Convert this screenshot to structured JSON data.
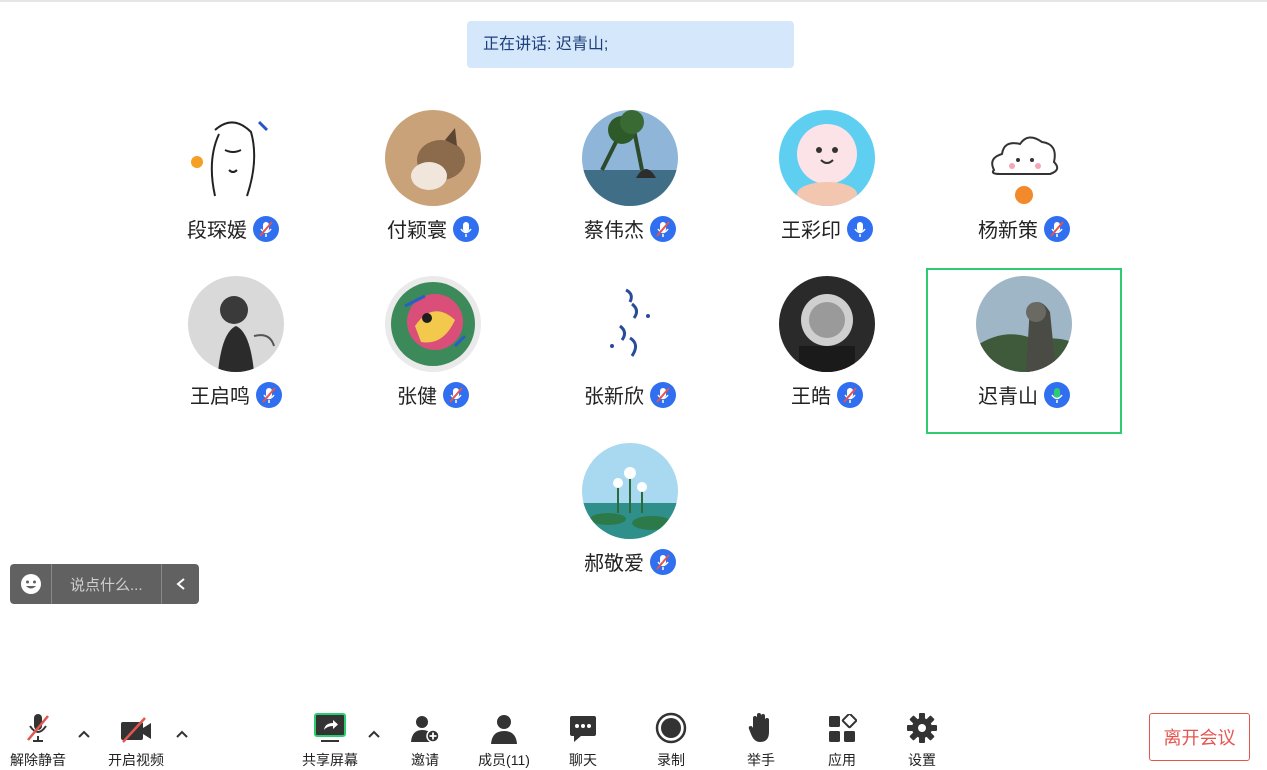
{
  "banner": {
    "speaking_text": "正在讲话: 迟青山;"
  },
  "participants": [
    {
      "name": "段琛媛"
    },
    {
      "name": "付颖寰"
    },
    {
      "name": "蔡伟杰"
    },
    {
      "name": "王彩印"
    },
    {
      "name": "杨新策"
    },
    {
      "name": "王启鸣"
    },
    {
      "name": "张健"
    },
    {
      "name": "张新欣"
    },
    {
      "name": "王皓"
    },
    {
      "name": "迟青山"
    },
    {
      "name": "郝敬爱"
    }
  ],
  "chat": {
    "placeholder": "说点什么..."
  },
  "toolbar": {
    "unmute": "解除静音",
    "start_video": "开启视频",
    "share_screen": "共享屏幕",
    "invite": "邀请",
    "members": "成员(11)",
    "chat": "聊天",
    "record": "录制",
    "raise_hand": "举手",
    "apps": "应用",
    "settings": "设置",
    "leave": "离开会议"
  },
  "colors": {
    "accent": "#2f6ff0",
    "speaking": "#2ecc71",
    "danger": "#e5554f",
    "banner_bg": "#d5e7fb"
  }
}
